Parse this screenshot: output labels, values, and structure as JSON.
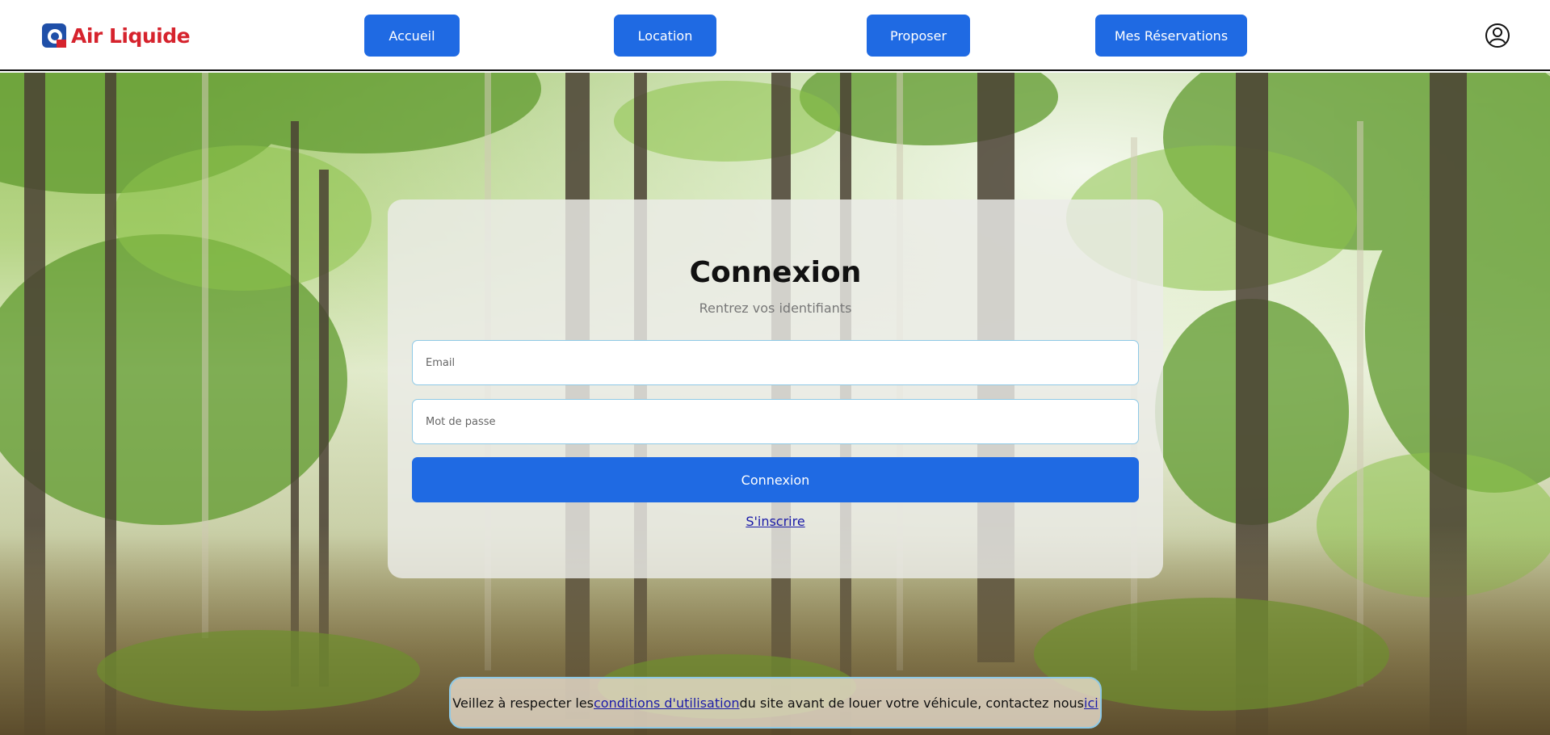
{
  "header": {
    "logo": {
      "brand_word_1": "Air",
      "brand_word_2": "Liquide",
      "color": "#d6232d",
      "mark_color": "#1f4fa8"
    },
    "nav": [
      {
        "label": "Accueil"
      },
      {
        "label": "Location"
      },
      {
        "label": "Proposer"
      },
      {
        "label": "Mes Réservations"
      }
    ],
    "profile_icon": "user-circle-icon",
    "accent_color": "#1f6ae3"
  },
  "login": {
    "title": "Connexion",
    "subtitle": "Rentrez vos identifiants",
    "email_placeholder": "Email",
    "email_value": "",
    "password_placeholder": "Mot de passe",
    "password_value": "",
    "submit_label": "Connexion",
    "signup_label": "S'inscrire"
  },
  "notice": {
    "text_before": "Veillez à respecter les ",
    "terms_link": "conditions d'utilisation",
    "text_middle": " du site avant de louer votre véhicule, contactez nous ",
    "contact_link": "ici"
  }
}
